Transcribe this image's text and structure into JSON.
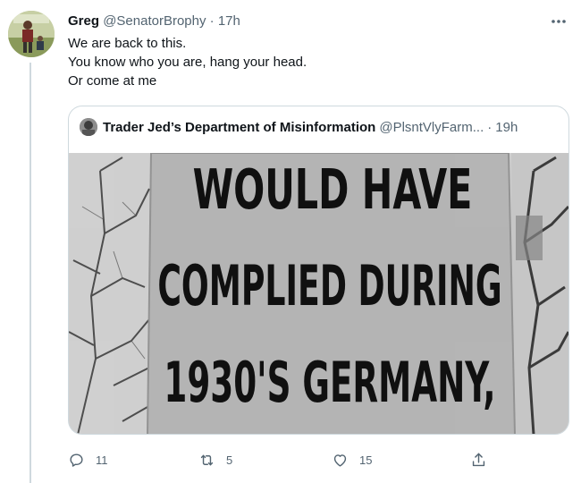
{
  "tweet": {
    "name": "Greg",
    "handle": "@SenatorBrophy",
    "separator": "·",
    "time": "17h",
    "more_icon": "ellipsis-icon",
    "lines": [
      "We are back to this.",
      "You know who you are, hang your head.",
      "Or come at me"
    ]
  },
  "quote": {
    "name": "Trader Jed’s Department of Misinformation",
    "handle": "@PlsntVlyFarm...",
    "separator": "·",
    "time": "19h",
    "image": {
      "sign_lines": [
        "WOULD HAVE",
        "COMPLIED DURING",
        "1930'S GERMANY,"
      ]
    }
  },
  "actions": {
    "reply": {
      "icon": "reply-icon",
      "count": "11"
    },
    "retweet": {
      "icon": "retweet-icon",
      "count": "5"
    },
    "like": {
      "icon": "heart-icon",
      "count": "15"
    },
    "share": {
      "icon": "share-icon"
    }
  },
  "colors": {
    "text_primary": "#0f1419",
    "text_secondary": "#536471",
    "border": "#cfd9de"
  }
}
